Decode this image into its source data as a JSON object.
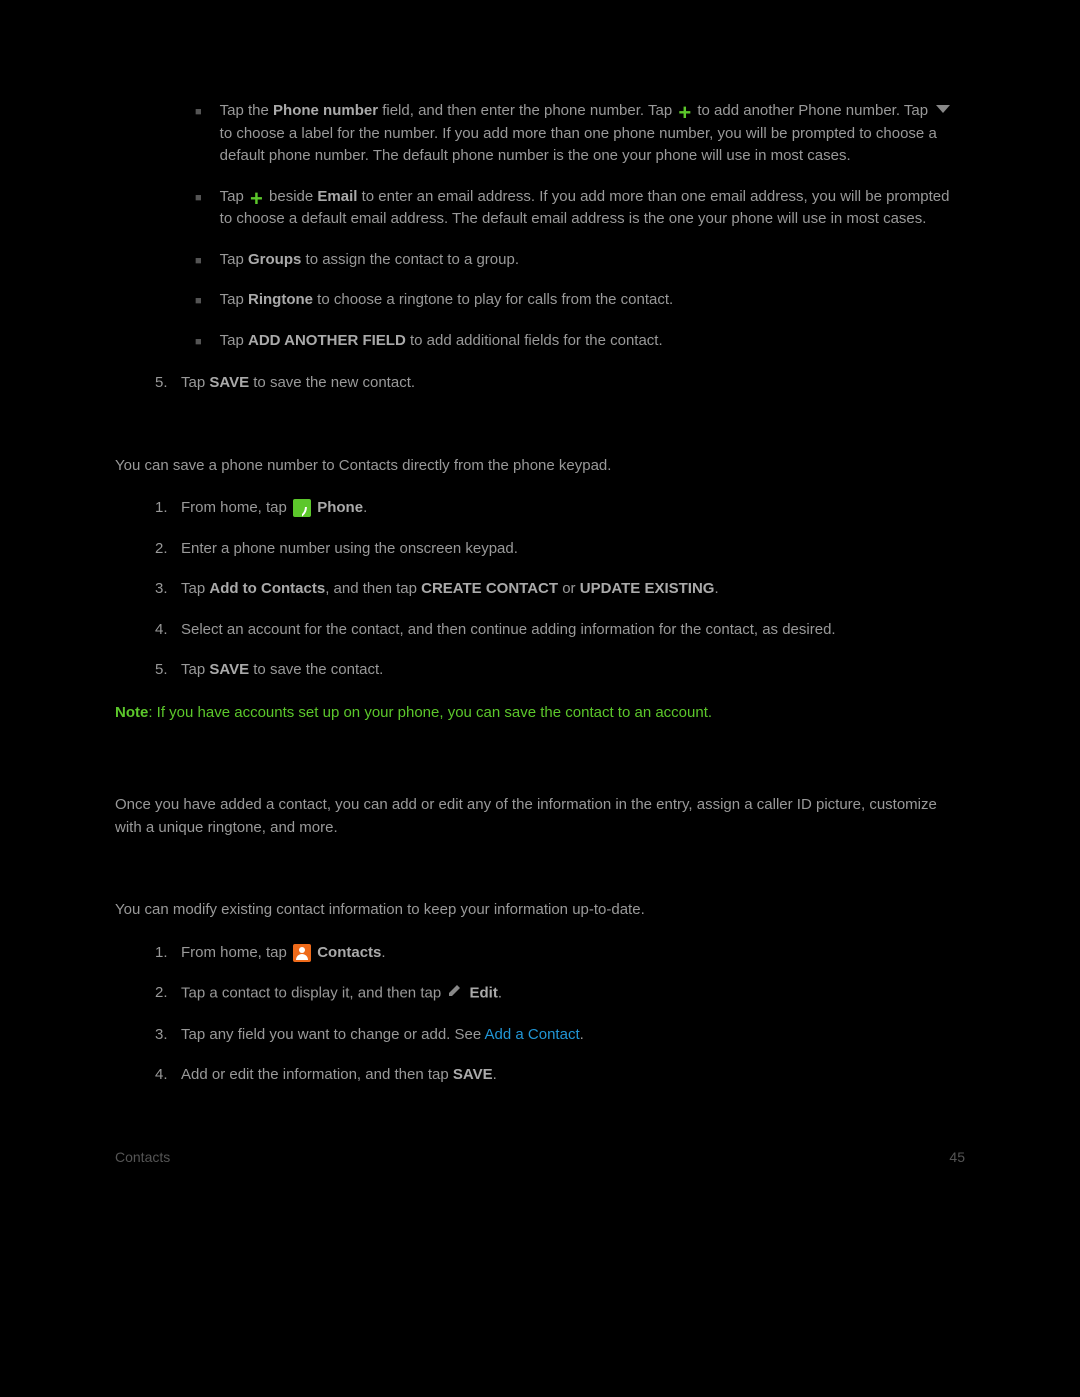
{
  "bullets": {
    "b1a": "Tap the ",
    "b1b": "Phone number",
    "b1c": " field, and then enter the phone number. Tap ",
    "b1d": " to add another Phone number. Tap ",
    "b1e": " to choose a label for the number. If you add more than one phone number, you will be prompted to choose a default phone number. The default phone number is the one your phone will use in most cases.",
    "b2a": "Tap ",
    "b2b": " beside ",
    "b2c": "Email",
    "b2d": " to enter an email address. If you add more than one email address, you will be prompted to choose a default email address. The default email address is the one your phone will use in most cases.",
    "b3a": "Tap ",
    "b3b": "Groups",
    "b3c": " to assign the contact to a group.",
    "b4a": "Tap ",
    "b4b": "Ringtone",
    "b4c": " to choose a ringtone to play for calls from the contact.",
    "b5a": "Tap ",
    "b5b": "ADD ANOTHER FIELD",
    "b5c": " to add additional fields for the contact."
  },
  "step5": {
    "num": "5.",
    "a": "Tap ",
    "b": "SAVE",
    "c": " to save the new contact."
  },
  "para1": "You can save a phone number to Contacts directly from the phone keypad.",
  "listA": {
    "i1": {
      "num": "1.",
      "a": "From home, tap ",
      "b": "Phone",
      "c": "."
    },
    "i2": {
      "num": "2.",
      "a": "Enter a phone number using the onscreen keypad."
    },
    "i3": {
      "num": "3.",
      "a": "Tap ",
      "b": "Add to Contacts",
      "c": ", and then tap ",
      "d": "CREATE CONTACT",
      "e": " or ",
      "f": "UPDATE EXISTING",
      "g": "."
    },
    "i4": {
      "num": "4.",
      "a": "Select an account for the contact, and then continue adding information for the contact, as desired."
    },
    "i5": {
      "num": "5.",
      "a": "Tap ",
      "b": "SAVE",
      "c": " to save the contact."
    }
  },
  "note": {
    "label": "Note",
    "text": ": If you have accounts set up on your phone, you can save the contact to an account."
  },
  "para2": "Once you have added a contact, you can add or edit any of the information in the entry, assign a caller ID picture, customize with a unique ringtone, and more.",
  "para3": "You can modify existing contact information to keep your information up-to-date.",
  "listB": {
    "i1": {
      "num": "1.",
      "a": "From home, tap ",
      "b": "Contacts",
      "c": "."
    },
    "i2": {
      "num": "2.",
      "a": "Tap a contact to display it, and then tap ",
      "b": "Edit",
      "c": "."
    },
    "i3": {
      "num": "3.",
      "a": "Tap any field you want to change or add. See ",
      "link": "Add a Contact",
      "c": "."
    },
    "i4": {
      "num": "4.",
      "a": "Add or edit the information, and then tap ",
      "b": "SAVE",
      "c": "."
    }
  },
  "footer": {
    "section": "Contacts",
    "page": "45"
  }
}
